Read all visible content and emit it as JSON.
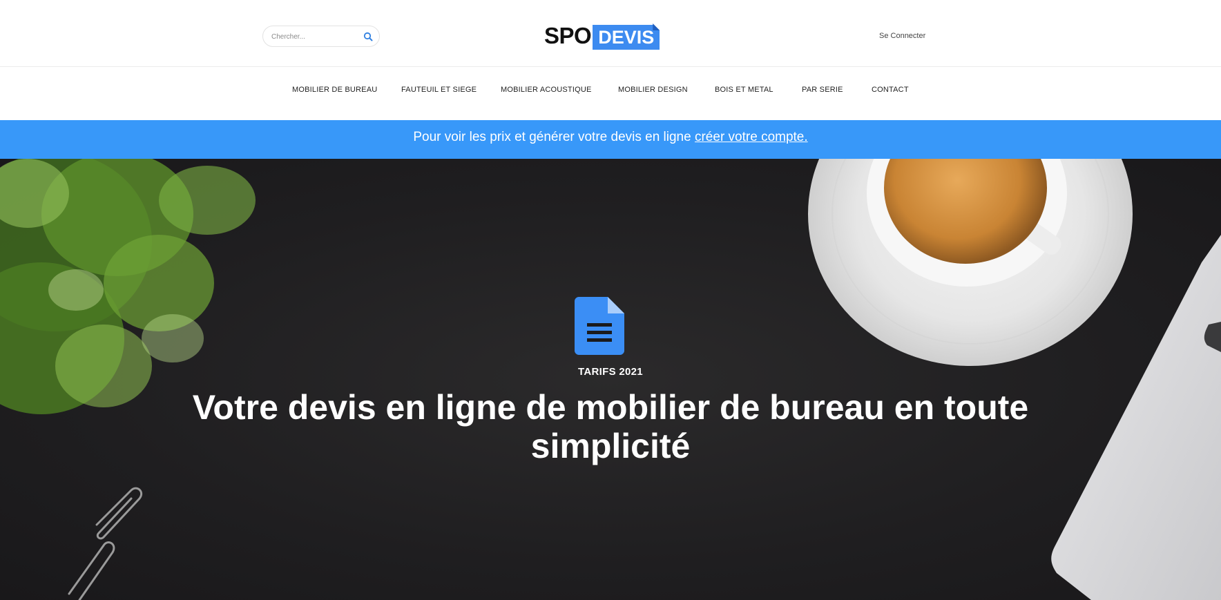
{
  "header": {
    "search_placeholder": "Chercher...",
    "logo_part1": "SPO",
    "logo_part2": "DEVIS",
    "login_label": "Se Connecter"
  },
  "nav": {
    "items": [
      {
        "label": "MOBILIER DE BUREAU"
      },
      {
        "label": "FAUTEUIL ET SIEGE"
      },
      {
        "label": "MOBILIER ACOUSTIQUE"
      },
      {
        "label": "MOBILIER DESIGN"
      },
      {
        "label": "BOIS ET METAL"
      },
      {
        "label": "PAR SERIE"
      },
      {
        "label": "CONTACT"
      }
    ]
  },
  "banner": {
    "text": "Pour voir les prix et générer votre devis en ligne",
    "link_label": "créer votre compte."
  },
  "hero": {
    "kicker": "TARIFS 2021",
    "title": "Votre devis en ligne de mobilier de bureau en toute simplicité"
  },
  "colors": {
    "accent": "#3898f9",
    "logo_blue": "#3d8bf0",
    "hero_bg": "#1f1e20"
  },
  "icons": {
    "search": "search-icon",
    "document": "document-icon"
  }
}
